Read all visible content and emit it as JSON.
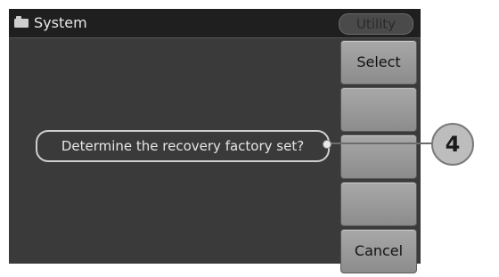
{
  "titlebar": {
    "icon": "folder-icon",
    "title": "System"
  },
  "badge": {
    "label": "Utility"
  },
  "softkeys": [
    {
      "label": "Select"
    },
    {
      "label": ""
    },
    {
      "label": ""
    },
    {
      "label": ""
    },
    {
      "label": "Cancel"
    }
  ],
  "dialog": {
    "message": "Determine the recovery factory set?"
  },
  "callout": {
    "number": "4"
  }
}
